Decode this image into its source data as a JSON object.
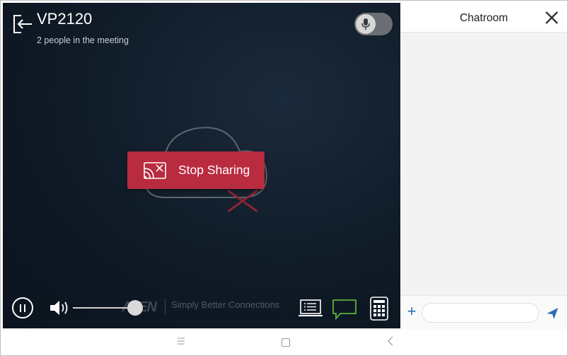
{
  "meeting": {
    "title": "VP2120",
    "subtitle": "2 people in the meeting",
    "stop_sharing_label": "Stop Sharing",
    "logo_text": "ATEN",
    "tagline": "Simply Better Connections",
    "volume_level": 0.8,
    "mic_enabled": false
  },
  "chat": {
    "title": "Chatroom",
    "input_value": "",
    "input_placeholder": ""
  },
  "icons": {
    "back": "exit-arrow-icon",
    "mic": "microphone-icon",
    "cloud": "cloud-disconnected-icon",
    "stop_share": "cast-stop-icon",
    "pause": "pause-icon",
    "volume": "speaker-icon",
    "list": "laptop-list-icon",
    "chat": "chat-bubble-icon",
    "keypad": "keypad-icon",
    "close": "close-icon",
    "add": "plus-icon",
    "send": "send-icon",
    "nav_menu": "menu-icon",
    "nav_home": "home-icon",
    "nav_back": "back-icon"
  },
  "colors": {
    "stop_sharing_bg": "#b92b3f",
    "chat_active": "#5fb03a",
    "accent_blue": "#2c6fb3",
    "meeting_bg": "#0f1a26"
  }
}
